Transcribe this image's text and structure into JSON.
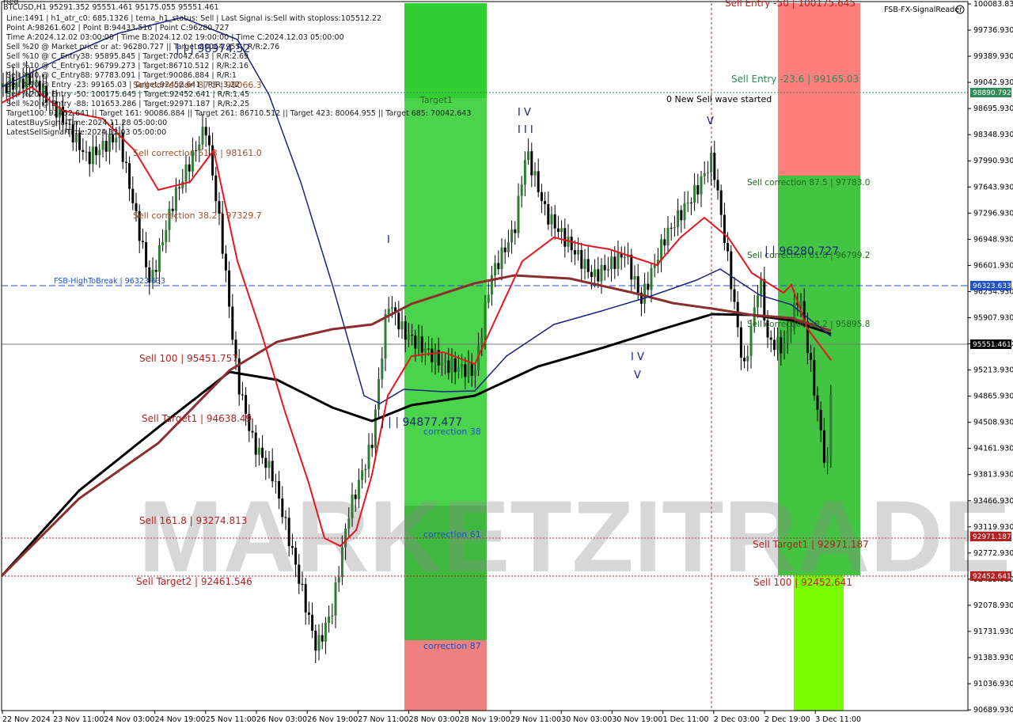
{
  "header": {
    "symbol": "BTCUSD,H1",
    "ohlc": "95291.352 95551.461 95175.055 95551.461",
    "corner_label": "rted",
    "brand": "FSB-FX-SignalReader",
    "lines": [
      "Line:1491 | h1_atr_c0: 685.1326 | tema_h1_status: Sell | Last Signal is:Sell with stoploss:105512.22",
      "Point A:98261.602 | Point B:94433.516 | Point C:96280.727",
      "Time A:2024.12.02 03:00:00 | Time B:2024.12.02 19:00:00 | Time C:2024.12.03 05:00:00",
      "Sell %20 @ Market price or at: 96280.727 || Target:80064.955 | R/R:2.76",
      "Sell %10 @ C_Entry38: 95895.845 | Target:70042.643 | R/R:2.69",
      "Sell %10 @ C_Entry61: 96799.273 | Target:86710.512 | R/R:2.16",
      "Sell %10 @ C_Entry88: 97783.091 | Target:90086.884 | R/R:1",
      "Sell %10 @ Entry -23: 99165.03 | Target:92452.641 | R/R:3.22",
      "Sell %20 @ Entry -50: 100175.645 | Target:92452.641 | R/R:1.45",
      "Sell %20 @ Entry -88: 101653.286 | Target:92971.187 | R/R:2.25",
      "Target100: 92452.641 || Target 161: 90086.884 || Target 261: 86710.512 || Target 423: 80064.955 || Target 685: 70042.643",
      "LatestBuySignalTime:2024.11.28 05:00:00",
      "LatestSellSignalTime:2024.12.03 05:00:00"
    ]
  },
  "price_axis": {
    "ticks": [
      "100083.830",
      "99736.930",
      "99389.930",
      "99042.930",
      "98695.930",
      "98348.930",
      "98001.930",
      "97654.930",
      "97307.930",
      "96960.930",
      "96613.930",
      "96266.930",
      "95919.930",
      "95572.930",
      "95225.930",
      "94878.930",
      "94531.930",
      "94184.930",
      "93837.930",
      "93490.930",
      "93143.930",
      "92796.930",
      "92449.930",
      "92102.930",
      "91755.930",
      "91408.930",
      "91061.930",
      "90714.930"
    ],
    "visible_ticks": [
      "100083.830",
      "99736.930",
      "99389.930",
      "99042.930",
      "98695.930",
      "98348.930",
      "97990.930",
      "97643.930",
      "97296.930",
      "96948.930",
      "96601.930",
      "96254.930",
      "95907.930",
      "95560.930",
      "95213.930",
      "94865.930",
      "94508.930",
      "94161.930",
      "93813.930",
      "93466.930",
      "93119.930",
      "92772.930",
      "92425.930",
      "92078.930",
      "91731.930",
      "91383.930",
      "91036.930",
      "90689.930"
    ]
  },
  "price_tags": [
    {
      "text": "98890.792",
      "color": "#2e8b57"
    },
    {
      "text": "96323.633",
      "color": "#1e50c8"
    },
    {
      "text": "95551.461",
      "color": "#000000"
    },
    {
      "text": "92971.187",
      "color": "#b22222"
    },
    {
      "text": "92452.641",
      "color": "#b22222"
    }
  ],
  "time_axis": {
    "labels": [
      "22 Nov 2024",
      "23 Nov 11:00",
      "24 Nov 03:00",
      "24 Nov 19:00",
      "25 Nov 11:00",
      "26 Nov 03:00",
      "26 Nov 19:00",
      "27 Nov 11:00",
      "28 Nov 03:00",
      "28 Nov 19:00",
      "29 Nov 11:00",
      "30 Nov 03:00",
      "30 Nov 19:00",
      "1 Dec 11:00",
      "2 Dec 03:00",
      "2 Dec 19:00",
      "3 Dec 11:00"
    ]
  },
  "levels": {
    "fsb_high_to_break": "FSB-HighToBreak | 96323.633",
    "sell_100_left": "Sell 100 | 95451.757",
    "sell_target1_left": "Sell Target1 | 94638.49",
    "sell_1618_left": "Sell 161.8 | 93274.813",
    "sell_target2_left": "Sell Target2 | 92461.546",
    "sell_correction_618": "Sell correction 61.8 | 98161.0",
    "sell_correction_382": "Sell correction 38.2 | 97329.7",
    "sell_correction_left_top": "Sell correction 87.5 | 99066.3",
    "point_c_left": "| | | 98974.52",
    "sell_entry_50": "Sell Entry -50 | 100175.645",
    "sell_entry_236": "Sell Entry -23.6 | 99165.03",
    "sell_correction_875": "Sell correction 87.5 | 97783.0",
    "sell_correction_618_right": "Sell correction 61.8 | 96799.2",
    "point_c_right": "| | 96280.727",
    "sell_correction_382_right": "Sell correction 38.2 | 95895.8",
    "sell_target1_right": "Sell Target1 | 92971.187",
    "sell_100_right": "Sell 100 | 92452.641",
    "new_wave": "0 New Sell wave started",
    "target1_zone": "Target1",
    "correction_38": "correction 38",
    "correction_61": "correction 61",
    "correction_87": "correction 87",
    "point_b": "| | | 94877.477",
    "wave_iv": "I V",
    "wave_v_top": "V",
    "wave_iv_top": "I V",
    "wave_iii": "I I I",
    "wave_v_mid": "V",
    "wave_i": "I"
  },
  "watermark": "MARKETZITRADE",
  "colors": {
    "bull": "#2e7d32",
    "bear": "#000000",
    "green_zone": "#22c322",
    "light_green_zone": "#7cfc00",
    "red_zone": "#ff6b6b",
    "ma_red": "#e8141e",
    "ma_blue": "#1a237e",
    "ma_black": "#000000",
    "ma_brown": "#8b2e2e"
  }
}
